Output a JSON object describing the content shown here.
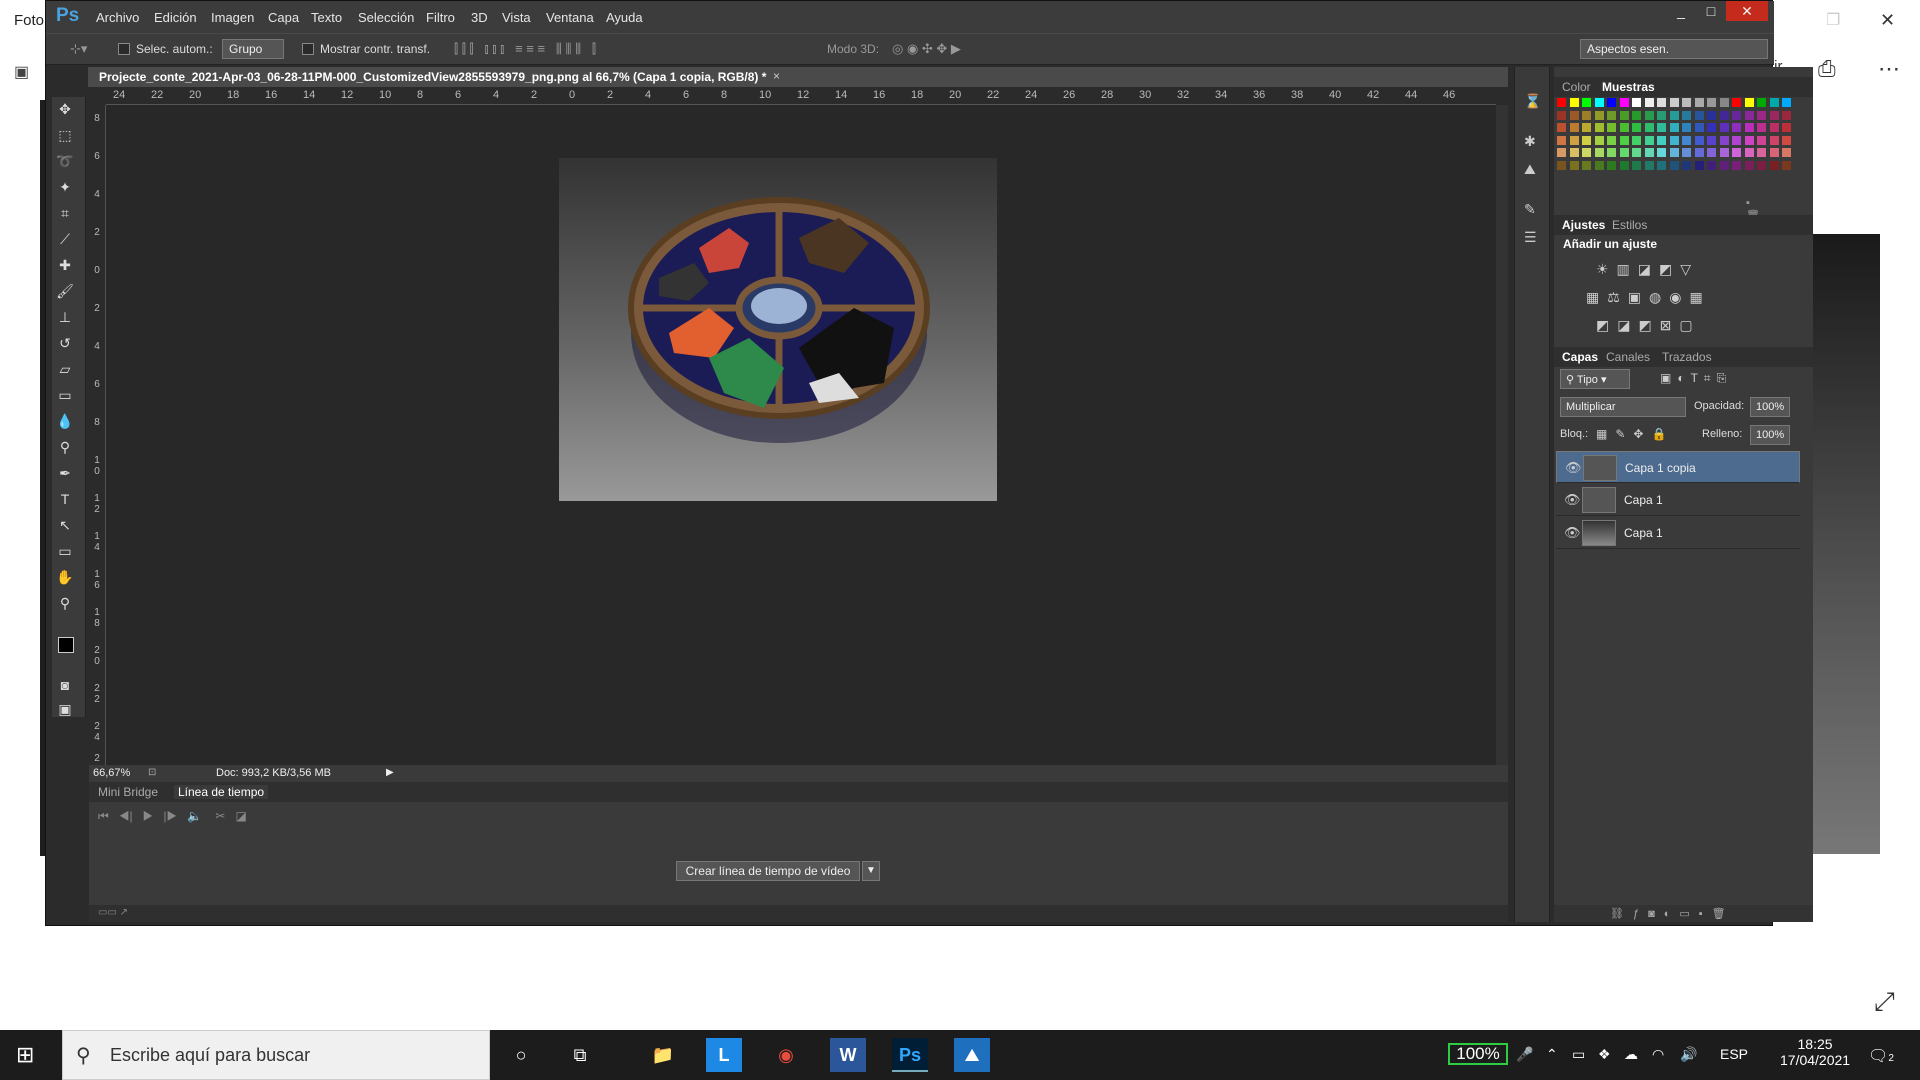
{
  "background_app": {
    "title_partial": "Foto",
    "tir_partial": "tir"
  },
  "ps": {
    "logo": "Ps",
    "menus": [
      "Archivo",
      "Edición",
      "Imagen",
      "Capa",
      "Texto",
      "Selección",
      "Filtro",
      "3D",
      "Vista",
      "Ventana",
      "Ayuda"
    ],
    "window_controls": {
      "minimize": "_",
      "restore": "□",
      "close": "✕"
    },
    "options": {
      "autoselect_label": "Selec. autom.:",
      "autoselect_value": "Grupo",
      "show_transform_label": "Mostrar contr. transf.",
      "mode3d_label": "Modo 3D:",
      "workspace": "Aspectos esen."
    },
    "document": {
      "tab_title": "Projecte_conte_2021-Apr-03_06-28-11PM-000_CustomizedView2855593979_png.png al 66,7% (Capa 1 copia, RGB/8) *",
      "tab_close": "×",
      "zoom": "66,67%",
      "doc_size": "Doc: 993,2 KB/3,56 MB"
    },
    "ruler_h": [
      "24",
      "22",
      "20",
      "18",
      "16",
      "14",
      "12",
      "10",
      "8",
      "6",
      "4",
      "2",
      "0",
      "2",
      "4",
      "6",
      "8",
      "10",
      "12",
      "14",
      "16",
      "18",
      "20",
      "22",
      "24",
      "26",
      "28",
      "30",
      "32",
      "34",
      "36",
      "38",
      "40",
      "42",
      "44",
      "46"
    ],
    "ruler_v": [
      "8",
      "6",
      "4",
      "2",
      "0",
      "2",
      "4",
      "6",
      "8",
      "1 0",
      "1 2",
      "1 4",
      "1 6",
      "1 8",
      "2 0",
      "2 2",
      "2 4",
      "2"
    ],
    "timeline": {
      "tabs": [
        "Mini Bridge",
        "Línea de tiempo"
      ],
      "create_button": "Crear línea de tiempo de vídeo",
      "dropdown_arrow": "▼"
    },
    "panels": {
      "color_tabs": [
        "Color",
        "Muestras"
      ],
      "adjust_tabs": [
        "Ajustes",
        "Estilos"
      ],
      "adjust_title": "Añadir un ajuste",
      "layer_tabs": [
        "Capas",
        "Canales",
        "Trazados"
      ],
      "layer_filter": "Tipo",
      "blend_mode": "Multiplicar",
      "opacity_label": "Opacidad:",
      "opacity_value": "100%",
      "lock_label": "Bloq.:",
      "fill_label": "Relleno:",
      "fill_value": "100%",
      "layers": [
        {
          "name": "Capa 1 copia",
          "selected": true
        },
        {
          "name": "Capa 1",
          "selected": false
        },
        {
          "name": "Capa 1",
          "selected": false
        }
      ]
    }
  },
  "taskbar": {
    "search_placeholder": "Escribe aquí para buscar",
    "battery": "100%",
    "language": "ESP",
    "time": "18:25",
    "date": "17/04/2021",
    "notifications": "2"
  },
  "colors": {
    "ps_blue": "#4aa3df",
    "selected_layer": "#4d6a8f",
    "battery_outline": "#2ecc40"
  }
}
